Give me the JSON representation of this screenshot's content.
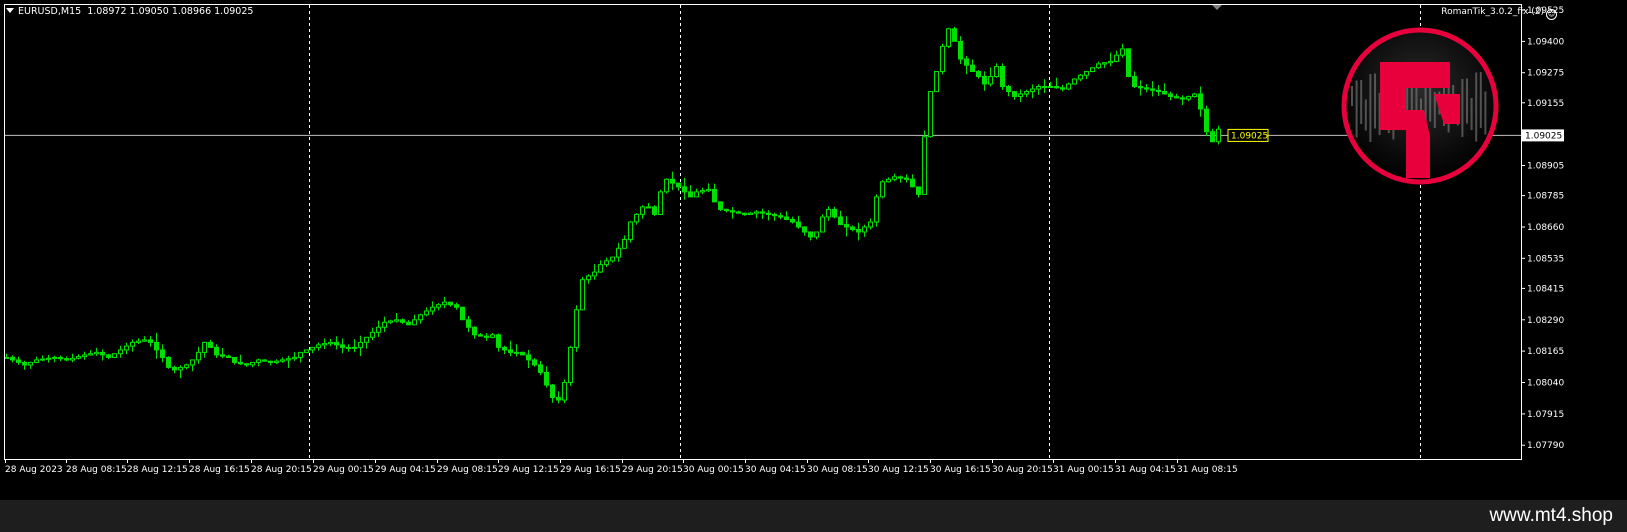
{
  "header": {
    "symbol_tf": "EURUSD,M15",
    "ohlc": "1.08972 1.09050 1.08966 1.09025"
  },
  "indicator": {
    "name": "RomanTik_3.0.2_fix (2)"
  },
  "footer": {
    "watermark": "www.mt4.shop"
  },
  "colors": {
    "background": "#000000",
    "candle": "#00e000",
    "grid": "#ffffff",
    "bid_line": "#c0c0c0",
    "price_label": "#ffff00",
    "logo_red": "#e8003c"
  },
  "chart_data": {
    "type": "candlestick",
    "symbol": "EURUSD",
    "timeframe": "M15",
    "ylim": [
      1.07735,
      1.09545
    ],
    "y_ticks": [
      "1.09525",
      "1.09400",
      "1.09275",
      "1.09155",
      "1.09025",
      "1.08905",
      "1.08785",
      "1.08660",
      "1.08535",
      "1.08415",
      "1.08290",
      "1.08165",
      "1.08040",
      "1.07915",
      "1.07790"
    ],
    "x_ticks": [
      "28 Aug 2023",
      "28 Aug 08:15",
      "28 Aug 12:15",
      "28 Aug 16:15",
      "28 Aug 20:15",
      "29 Aug 00:15",
      "29 Aug 04:15",
      "29 Aug 08:15",
      "29 Aug 12:15",
      "29 Aug 16:15",
      "29 Aug 20:15",
      "30 Aug 00:15",
      "30 Aug 04:15",
      "30 Aug 08:15",
      "30 Aug 12:15",
      "30 Aug 16:15",
      "30 Aug 20:15",
      "31 Aug 00:15",
      "31 Aug 04:15",
      "31 Aug 08:15"
    ],
    "day_separators": [
      "29 Aug",
      "30 Aug",
      "31 Aug",
      "1 Sep"
    ],
    "current_price": "1.09025",
    "grid": false,
    "price_path": [
      [
        0,
        1.0814
      ],
      [
        3,
        1.0811
      ],
      [
        5,
        1.0813
      ],
      [
        8,
        1.0814
      ],
      [
        10,
        1.0813
      ],
      [
        13,
        1.0815
      ],
      [
        15,
        1.0816
      ],
      [
        17,
        1.0814
      ],
      [
        19,
        1.0817
      ],
      [
        21,
        1.082
      ],
      [
        23,
        1.0821
      ],
      [
        24,
        1.082
      ],
      [
        26,
        1.0814
      ],
      [
        27,
        1.081
      ],
      [
        28,
        1.0809
      ],
      [
        30,
        1.0811
      ],
      [
        31,
        1.0813
      ],
      [
        32,
        1.0816
      ],
      [
        33,
        1.082
      ],
      [
        34,
        1.0818
      ],
      [
        35,
        1.0815
      ],
      [
        37,
        1.0814
      ],
      [
        38,
        1.0812
      ],
      [
        40,
        1.0811
      ],
      [
        42,
        1.0813
      ],
      [
        44,
        1.0812
      ],
      [
        46,
        1.0813
      ],
      [
        48,
        1.0814
      ],
      [
        49,
        1.0816
      ],
      [
        51,
        1.0818
      ],
      [
        52,
        1.0819
      ],
      [
        54,
        1.082
      ],
      [
        56,
        1.0818
      ],
      [
        58,
        1.0818
      ],
      [
        60,
        1.0822
      ],
      [
        62,
        1.0826
      ],
      [
        63,
        1.0828
      ],
      [
        65,
        1.0829
      ],
      [
        67,
        1.0827
      ],
      [
        69,
        1.0831
      ],
      [
        71,
        1.0834
      ],
      [
        73,
        1.0836
      ],
      [
        75,
        1.0834
      ],
      [
        76,
        1.0829
      ],
      [
        77,
        1.0826
      ],
      [
        78,
        1.0823
      ],
      [
        80,
        1.0822
      ],
      [
        81,
        1.0823
      ],
      [
        82,
        1.0818
      ],
      [
        84,
        1.0816
      ],
      [
        85,
        1.0816
      ],
      [
        86,
        1.0815
      ],
      [
        87,
        1.0813
      ],
      [
        88,
        1.0811
      ],
      [
        89,
        1.0808
      ],
      [
        90,
        1.0803
      ],
      [
        91,
        1.0798
      ],
      [
        92,
        1.0797
      ],
      [
        93,
        1.0804
      ],
      [
        94,
        1.0818
      ],
      [
        95,
        1.0833
      ],
      [
        96,
        1.0845
      ],
      [
        98,
        1.0848
      ],
      [
        99,
        1.0851
      ],
      [
        101,
        1.0854
      ],
      [
        103,
        1.0861
      ],
      [
        104,
        1.0868
      ],
      [
        106,
        1.0874
      ],
      [
        107,
        1.0874
      ],
      [
        108,
        1.0871
      ],
      [
        109,
        1.088
      ],
      [
        110,
        1.0885
      ],
      [
        112,
        1.0882
      ],
      [
        114,
        1.0878
      ],
      [
        115,
        1.088
      ],
      [
        117,
        1.0881
      ],
      [
        118,
        1.0876
      ],
      [
        119,
        1.0873
      ],
      [
        121,
        1.0872
      ],
      [
        123,
        1.0871
      ],
      [
        125,
        1.0872
      ],
      [
        127,
        1.0871
      ],
      [
        129,
        1.087
      ],
      [
        131,
        1.0868
      ],
      [
        133,
        1.0864
      ],
      [
        134,
        1.0862
      ],
      [
        135,
        1.0864
      ],
      [
        136,
        1.087
      ],
      [
        137,
        1.0873
      ],
      [
        139,
        1.0867
      ],
      [
        140,
        1.0866
      ],
      [
        142,
        1.0864
      ],
      [
        144,
        1.0868
      ],
      [
        145,
        1.0878
      ],
      [
        146,
        1.0884
      ],
      [
        148,
        1.0886
      ],
      [
        150,
        1.0885
      ],
      [
        152,
        1.0879
      ],
      [
        153,
        1.0902
      ],
      [
        154,
        1.092
      ],
      [
        155,
        1.0928
      ],
      [
        156,
        1.0938
      ],
      [
        157,
        1.0945
      ],
      [
        158,
        1.094
      ],
      [
        159,
        1.0933
      ],
      [
        161,
        1.0928
      ],
      [
        162,
        1.0926
      ],
      [
        163,
        1.0923
      ],
      [
        164,
        1.0926
      ],
      [
        165,
        1.093
      ],
      [
        166,
        1.0922
      ],
      [
        168,
        1.0918
      ],
      [
        170,
        1.092
      ],
      [
        172,
        1.0922
      ],
      [
        174,
        1.0922
      ],
      [
        176,
        1.0921
      ],
      [
        178,
        1.0925
      ],
      [
        180,
        1.0928
      ],
      [
        182,
        1.0931
      ],
      [
        184,
        1.0932
      ],
      [
        186,
        1.0937
      ],
      [
        187,
        1.0926
      ],
      [
        188,
        1.0922
      ],
      [
        190,
        1.0921
      ],
      [
        192,
        1.092
      ],
      [
        194,
        1.0918
      ],
      [
        196,
        1.0917
      ],
      [
        198,
        1.0919
      ],
      [
        199,
        1.0913
      ],
      [
        200,
        1.0904
      ],
      [
        201,
        1.09
      ],
      [
        202,
        1.0905
      ]
    ]
  }
}
